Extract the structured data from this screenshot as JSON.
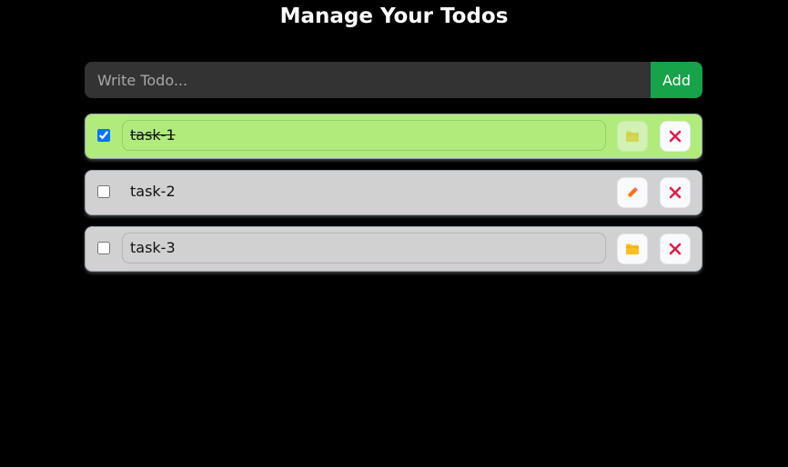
{
  "header": {
    "title": "Manage Your Todos"
  },
  "form": {
    "placeholder": "Write Todo...",
    "add_label": "Add"
  },
  "colors": {
    "completed_bg": "#b1eb7c",
    "pending_bg": "#d1d1d1",
    "add_button": "#16a34a",
    "delete_icon": "#e11d48",
    "folder_icon": "#fbbf24",
    "pencil_icon": "#f97316"
  },
  "todos": [
    {
      "text": "task-1",
      "completed": true,
      "editing": true,
      "edit_icon": "folder-icon",
      "delete_icon": "close-icon"
    },
    {
      "text": "task-2",
      "completed": false,
      "editing": false,
      "edit_icon": "pencil-icon",
      "delete_icon": "close-icon"
    },
    {
      "text": "task-3",
      "completed": false,
      "editing": true,
      "edit_icon": "folder-icon",
      "delete_icon": "close-icon"
    }
  ]
}
